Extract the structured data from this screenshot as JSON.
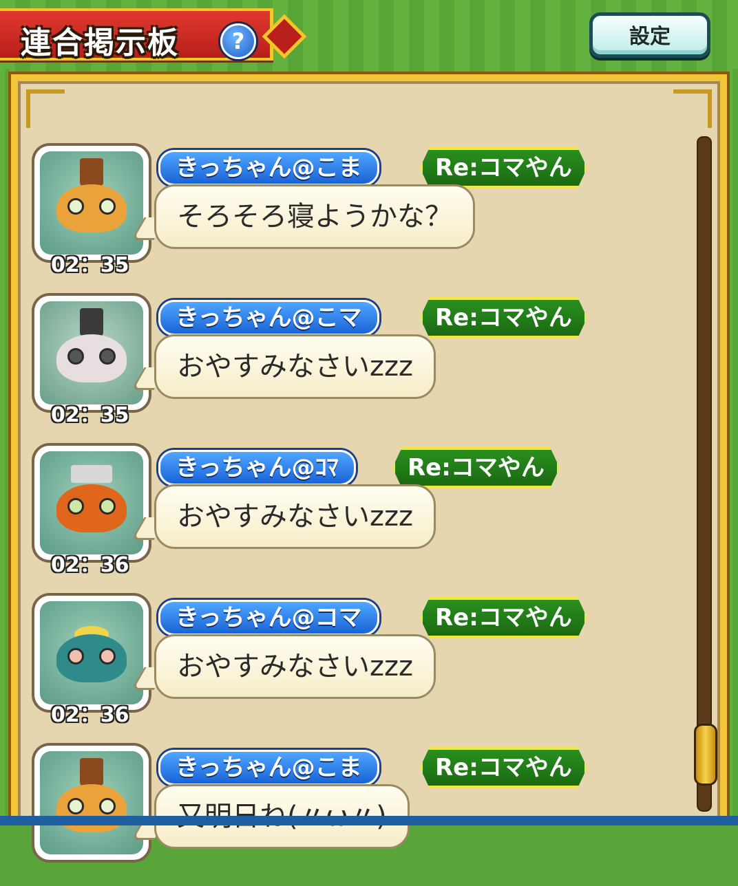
{
  "header": {
    "title": "連合掲示板",
    "help_icon": "?",
    "settings_label": "設定"
  },
  "colors": {
    "background_green": "#5aa53a",
    "banner_red": "#c9271f",
    "board_tan": "#e6d6b0",
    "name_blue": "#1a63d6",
    "reply_green": "#1a6a12"
  },
  "messages": [
    {
      "name": "きっちゃん@こま",
      "reply": "Re:コマやん",
      "text": "そろそろ寝ようかな？",
      "time": "02：35",
      "avatar": "orange-mushroom-yokai"
    },
    {
      "name": "きっちゃん@こマ",
      "reply": "Re:コマやん",
      "text": "おやすみなさいzzz",
      "time": "02：35",
      "avatar": "panda-mushroom-yokai"
    },
    {
      "name": "きっちゃん@ｺﾏ",
      "reply": "Re:コマやん",
      "text": "おやすみなさいzzz",
      "time": "02：36",
      "avatar": "orange-frog-yokai"
    },
    {
      "name": "きっちゃん@コマ",
      "reply": "Re:コマやん",
      "text": "おやすみなさいzzz",
      "time": "02：36",
      "avatar": "teal-mushroom-yokai"
    },
    {
      "name": "きっちゃん@こま",
      "reply": "Re:コマやん",
      "text": "又明日ね(〃ω〃)",
      "time": "",
      "avatar": "orange-mushroom-yokai"
    }
  ]
}
